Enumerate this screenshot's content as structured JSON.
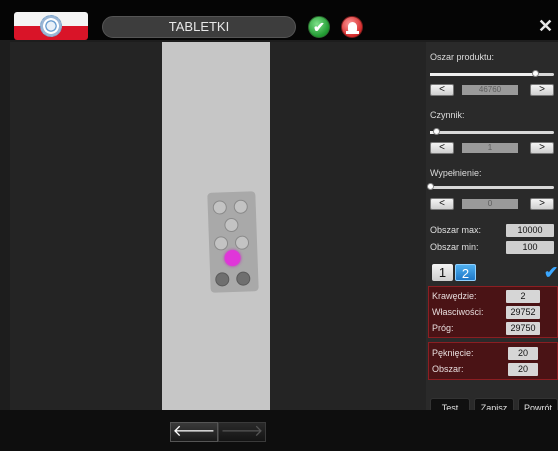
{
  "header": {
    "title": "TABLETKI",
    "close_label": "✕",
    "ok_icon": "checkmark-icon",
    "alarm_icon": "alarm-lamp-icon"
  },
  "panel": {
    "area": {
      "label": "Oszar produktu:",
      "value": "46760",
      "level": 0.85
    },
    "factor": {
      "label": "Czynnik:",
      "value": "1",
      "level": 0.05
    },
    "fill": {
      "label": "Wypełnienie:",
      "value": "0",
      "level": 0.0
    },
    "area_max": {
      "label": "Obszar max:",
      "value": "10000"
    },
    "area_min": {
      "label": "Obszar min:",
      "value": "100"
    },
    "tabs": [
      "1",
      "2"
    ],
    "active_tab": "2",
    "checked": true,
    "group1": {
      "edges": {
        "label": "Krawędzie:",
        "value": "2"
      },
      "props": {
        "label": "Własciwości:",
        "value": "29752"
      },
      "threshold": {
        "label": "Próg:",
        "value": "29750"
      }
    },
    "group2": {
      "crack": {
        "label": "Pęknięcie:",
        "value": "20"
      },
      "area": {
        "label": "Obszar:",
        "value": "20"
      }
    },
    "actions": {
      "test": "Test",
      "save": "Zapisz",
      "back": "Powrót"
    },
    "stepper_prev": "<",
    "stepper_next": ">"
  },
  "footer": {
    "prev": "🡐",
    "next": "🡒"
  },
  "colors": {
    "accent": "#1e78c8",
    "danger": "#8b1e22",
    "pill": "#e036d9",
    "ok": "#1f9a30"
  }
}
